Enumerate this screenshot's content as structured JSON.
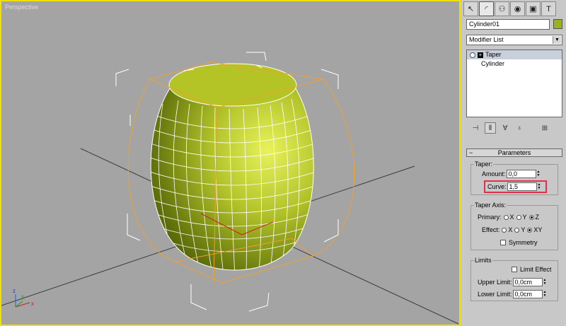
{
  "viewport": {
    "label": "Perspective",
    "object_color": "#9ab31a",
    "selection_color": "#f0a030",
    "border_color": "#f0e000"
  },
  "panel": {
    "tabs": [
      {
        "icon": "create-icon",
        "glyph": "↖"
      },
      {
        "icon": "modify-icon",
        "glyph": "◜"
      },
      {
        "icon": "hierarchy-icon",
        "glyph": "⚇"
      },
      {
        "icon": "motion-icon",
        "glyph": "◉"
      },
      {
        "icon": "display-icon",
        "glyph": "▣"
      },
      {
        "icon": "utilities-icon",
        "glyph": "T"
      }
    ],
    "object_name": "Cylinder01",
    "object_color": "#9ab31a",
    "modifier_list": "Modifier List",
    "stack": [
      {
        "label": "Taper",
        "selected": true
      },
      {
        "label": "Cylinder",
        "selected": false
      }
    ],
    "tools": [
      {
        "icon": "pin-stack-icon",
        "glyph": "⊣"
      },
      {
        "icon": "show-end-result-icon",
        "glyph": "Ⅱ"
      },
      {
        "icon": "make-unique-icon",
        "glyph": "∀"
      },
      {
        "icon": "remove-modifier-icon",
        "glyph": "♁"
      },
      {
        "icon": "configure-sets-icon",
        "glyph": "⊞"
      }
    ],
    "parameters": {
      "title": "Parameters",
      "taper_group": "Taper:",
      "amount_label": "Amount:",
      "amount_value": "0,0",
      "curve_label": "Curve:",
      "curve_value": "1,5",
      "axis_group": "Taper Axis:",
      "primary_label": "Primary:",
      "primary_options": [
        "X",
        "Y",
        "Z"
      ],
      "primary_selected": "Z",
      "effect_label": "Effect:",
      "effect_options": [
        "X",
        "Y",
        "XY"
      ],
      "effect_selected": "XY",
      "symmetry_label": "Symmetry",
      "limits_group": "Limits",
      "limit_effect_label": "Limit Effect",
      "upper_limit_label": "Upper Limit:",
      "upper_limit_value": "0,0cm",
      "lower_limit_label": "Lower Limit:",
      "lower_limit_value": "0,0cm"
    }
  }
}
